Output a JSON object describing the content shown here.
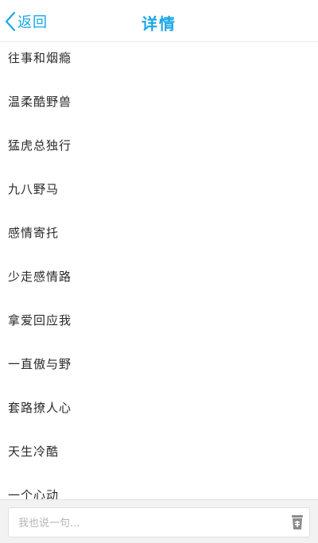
{
  "header": {
    "back_label": "返回",
    "title": "详情"
  },
  "items": [
    "往事和烟瘾",
    "温柔酷野兽",
    "猛虎总独行",
    "九八野马",
    "感情寄托",
    "少走感情路",
    "拿爱回应我",
    "一直傲与野",
    "套路撩人心",
    "天生冷酷",
    "一个心动"
  ],
  "comment": {
    "placeholder": "我也说一句..."
  },
  "colors": {
    "accent": "#1aa7e6"
  },
  "icons": {
    "back": "chevron-left-icon",
    "send": "cup-icon"
  }
}
